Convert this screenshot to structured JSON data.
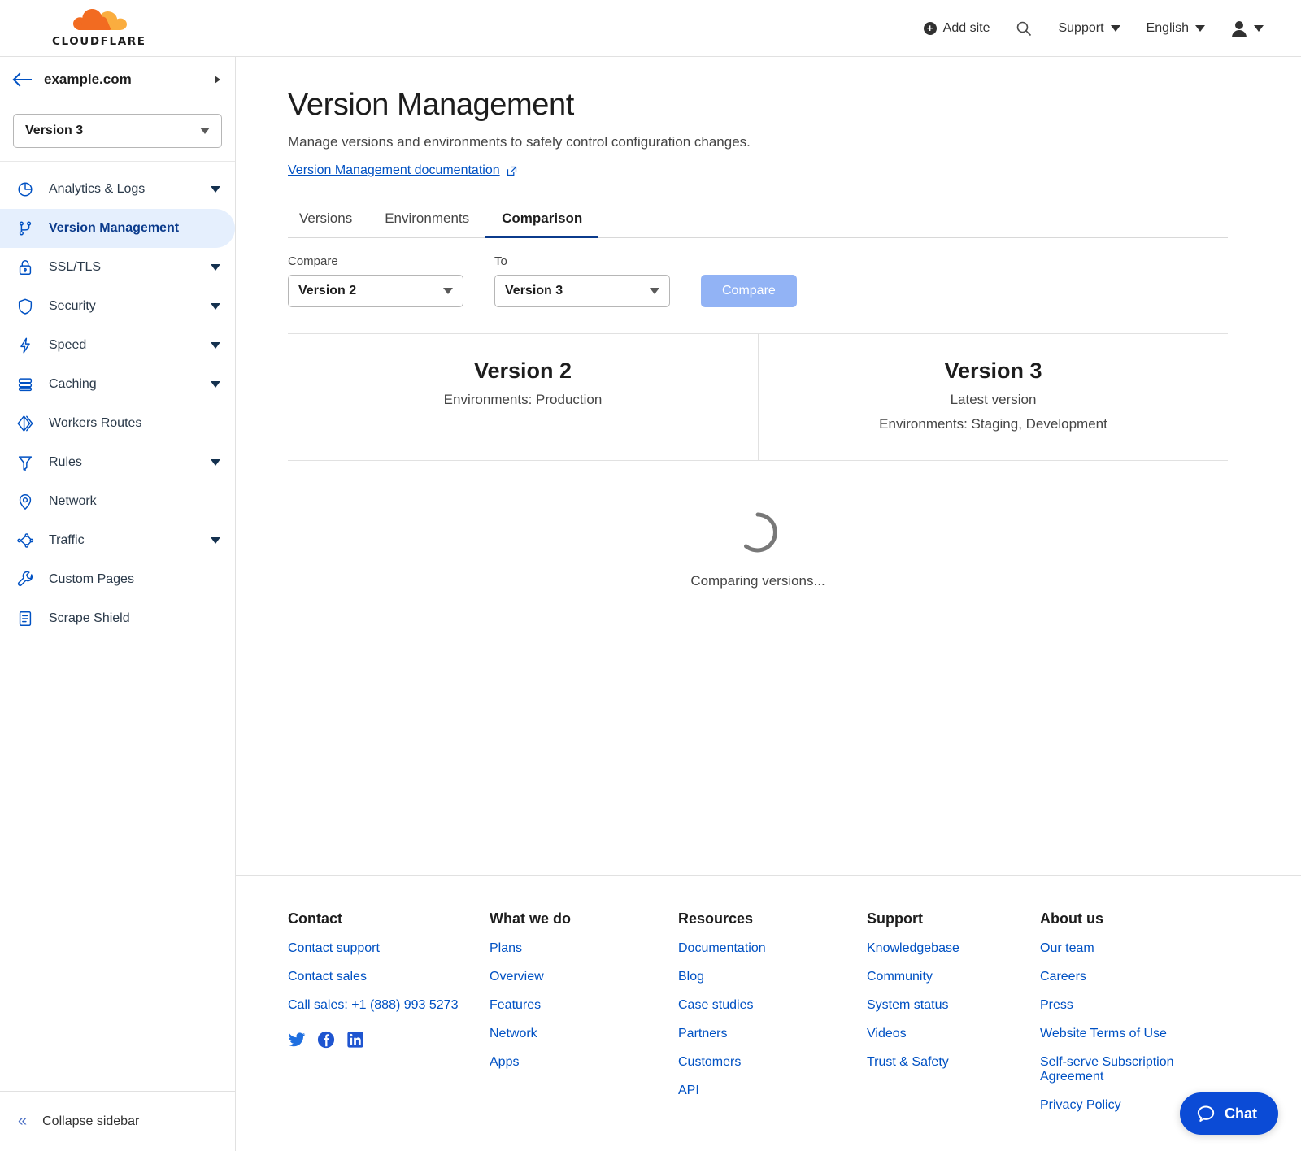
{
  "brand": {
    "name": "CLOUDFLARE",
    "logo_orange_dark": "#f26b21",
    "logo_orange_light": "#faad3f",
    "accent_blue": "#0051c3",
    "active_nav_bg": "#e5effd",
    "compare_button_bg": "#92b3f5",
    "chat_bg": "#0b4bd6"
  },
  "topbar": {
    "add_site": "Add site",
    "search_icon": "search-icon",
    "support": "Support",
    "language": "English",
    "account_icon": "user-avatar-icon"
  },
  "sidebar": {
    "domain": "example.com",
    "back_icon": "back-arrow-icon",
    "domain_caret_icon": "chevron-right-icon",
    "version_select": "Version 3",
    "items": [
      {
        "label": "Analytics & Logs",
        "icon": "analytics-pie-icon",
        "expandable": true,
        "active": false
      },
      {
        "label": "Version Management",
        "icon": "git-branch-icon",
        "expandable": false,
        "active": true
      },
      {
        "label": "SSL/TLS",
        "icon": "lock-icon",
        "expandable": true,
        "active": false
      },
      {
        "label": "Security",
        "icon": "shield-icon",
        "expandable": true,
        "active": false
      },
      {
        "label": "Speed",
        "icon": "lightning-bolt-icon",
        "expandable": true,
        "active": false
      },
      {
        "label": "Caching",
        "icon": "database-stack-icon",
        "expandable": true,
        "active": false
      },
      {
        "label": "Workers Routes",
        "icon": "workers-diamond-icon",
        "expandable": false,
        "active": false
      },
      {
        "label": "Rules",
        "icon": "funnel-icon",
        "expandable": true,
        "active": false
      },
      {
        "label": "Network",
        "icon": "map-pin-icon",
        "expandable": false,
        "active": false
      },
      {
        "label": "Traffic",
        "icon": "traffic-nodes-icon",
        "expandable": true,
        "active": false
      },
      {
        "label": "Custom Pages",
        "icon": "wrench-icon",
        "expandable": false,
        "active": false
      },
      {
        "label": "Scrape Shield",
        "icon": "document-icon",
        "expandable": false,
        "active": false
      }
    ],
    "collapse_label": "Collapse sidebar",
    "collapse_icon": "double-chevron-left-icon"
  },
  "main": {
    "title": "Version Management",
    "subtitle": "Manage versions and environments to safely control configuration changes.",
    "doc_link": "Version Management documentation",
    "doc_link_icon": "external-link-icon",
    "tabs": [
      {
        "label": "Versions",
        "active": false
      },
      {
        "label": "Environments",
        "active": false
      },
      {
        "label": "Comparison",
        "active": true
      }
    ],
    "compare_form": {
      "compare_label": "Compare",
      "compare_value": "Version 2",
      "to_label": "To",
      "to_value": "Version 3",
      "button_label": "Compare"
    },
    "panels": [
      {
        "title": "Version 2",
        "latest": "",
        "environments": "Environments: Production"
      },
      {
        "title": "Version 3",
        "latest": "Latest version",
        "environments": "Environments: Staging, Development"
      }
    ],
    "loading": {
      "icon": "spinner-icon",
      "text": "Comparing versions..."
    }
  },
  "footer": {
    "columns": [
      {
        "heading": "Contact",
        "links": [
          "Contact support",
          "Contact sales",
          "Call sales: +1 (888) 993 5273"
        ],
        "socials": [
          "twitter-icon",
          "facebook-icon",
          "linkedin-icon"
        ]
      },
      {
        "heading": "What we do",
        "links": [
          "Plans",
          "Overview",
          "Features",
          "Network",
          "Apps"
        ]
      },
      {
        "heading": "Resources",
        "links": [
          "Documentation",
          "Blog",
          "Case studies",
          "Partners",
          "Customers",
          "API"
        ]
      },
      {
        "heading": "Support",
        "links": [
          "Knowledgebase",
          "Community",
          "System status",
          "Videos",
          "Trust & Safety"
        ]
      },
      {
        "heading": "About us",
        "links": [
          "Our team",
          "Careers",
          "Press",
          "Website Terms of Use",
          "Self-serve Subscription Agreement",
          "Privacy Policy"
        ]
      }
    ]
  },
  "chat": {
    "label": "Chat",
    "icon": "chat-bubble-icon"
  }
}
